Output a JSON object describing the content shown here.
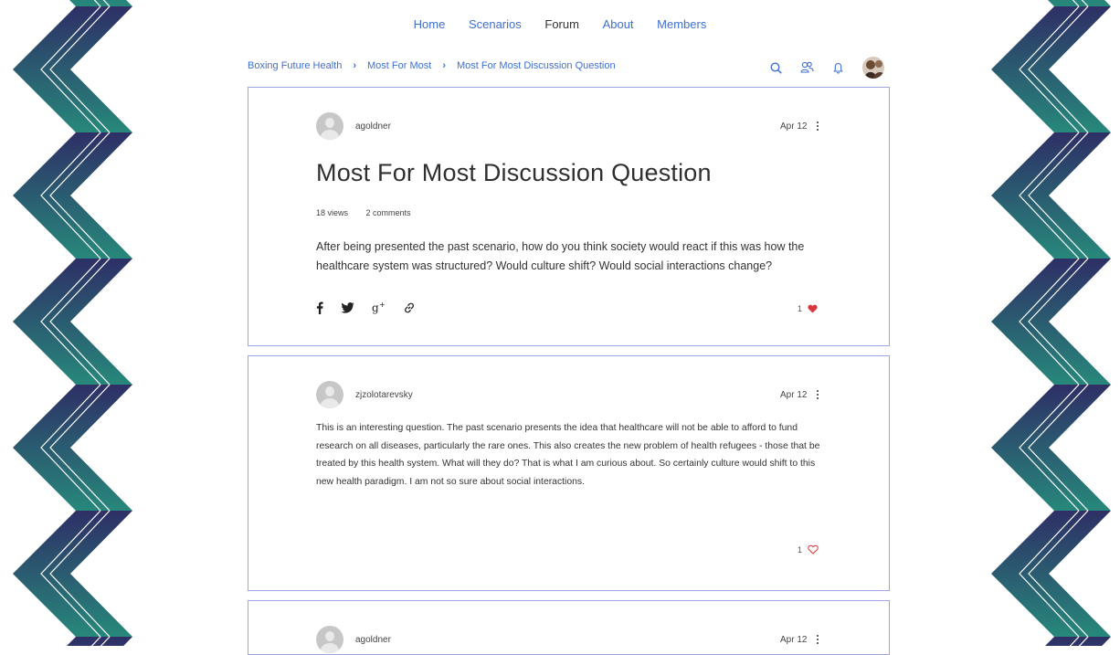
{
  "nav": {
    "items": [
      {
        "label": "Home"
      },
      {
        "label": "Scenarios"
      },
      {
        "label": "Forum"
      },
      {
        "label": "About"
      },
      {
        "label": "Members"
      }
    ],
    "active": "Forum"
  },
  "breadcrumb": {
    "items": [
      {
        "label": "Boxing Future Health"
      },
      {
        "label": "Most For Most"
      },
      {
        "label": "Most For Most Discussion Question"
      }
    ]
  },
  "toolbar": {
    "icons": [
      "search-icon",
      "members-icon",
      "notification-bell-icon",
      "user-avatar"
    ]
  },
  "post": {
    "author": "agoldner",
    "date": "Apr 12",
    "title": "Most For Most Discussion Question",
    "views": "18 views",
    "comments": "2 comments",
    "body": "After being presented the past scenario, how do you think society would react if this was how the healthcare system was structured? Would culture shift? Would social interactions change?",
    "likes": "1",
    "share_icons": [
      "facebook-icon",
      "twitter-icon",
      "google-plus-icon",
      "link-icon"
    ]
  },
  "comments": [
    {
      "author": "zjzolotarevsky",
      "date": "Apr 12",
      "body": "This is an interesting question. The past scenario presents the idea that healthcare will not be able to afford to fund research on all diseases, particularly the rare ones. This also creates the new problem of health refugees - those that be treated by this health system. What will they do? That is what I am curious about. So certainly culture would shift to this new health paradigm. I am not so sure about social interactions.",
      "likes": "1"
    },
    {
      "author": "agoldner",
      "date": "Apr 12"
    }
  ],
  "colors": {
    "accent": "#3f6fd1",
    "card_border": "#9aa7e3",
    "like_red": "#d9363e",
    "zigzag_top": "#2e2f66",
    "zigzag_bottom": "#27887b"
  }
}
